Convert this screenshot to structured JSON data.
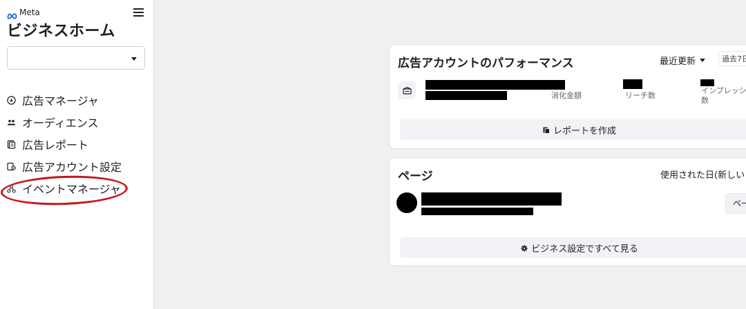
{
  "sidebar": {
    "brand_name": "Meta",
    "page_title": "ビジネスホーム",
    "account_selector_value": "",
    "nav_items": [
      {
        "label": "広告マネージャ",
        "icon": "navigation-icon"
      },
      {
        "label": "オーディエンス",
        "icon": "people-icon"
      },
      {
        "label": "広告レポート",
        "icon": "report-icon"
      },
      {
        "label": "広告アカウント設定",
        "icon": "ad-account-settings-icon"
      },
      {
        "label": "イベントマネージャ",
        "icon": "event-network-icon"
      }
    ],
    "highlighted_item": "イベントマネージャ",
    "highlight_color": "#c4161c"
  },
  "performance_card": {
    "title": "広告アカウントのパフォーマンス",
    "sort_label": "最近更新",
    "range_label": "過去7日",
    "account_icon": "ad-account-icon",
    "metrics": [
      {
        "label": "消化金額"
      },
      {
        "label": "リーチ数"
      },
      {
        "label": "インプレッシ",
        "label_line2": "数"
      }
    ],
    "create_report_label": "レポートを作成",
    "create_report_icon": "report-icon"
  },
  "pages_card": {
    "title": "ページ",
    "sort_label": "使用された日(新しい",
    "page_button_label": "ペー",
    "see_all_label": "ビジネス設定ですべて見る",
    "see_all_icon": "gear-icon"
  },
  "colors": {
    "background": "#f0f0f0",
    "card": "#ffffff",
    "button_bg": "#f0f2f5",
    "meta_blue": "#0668e1"
  }
}
